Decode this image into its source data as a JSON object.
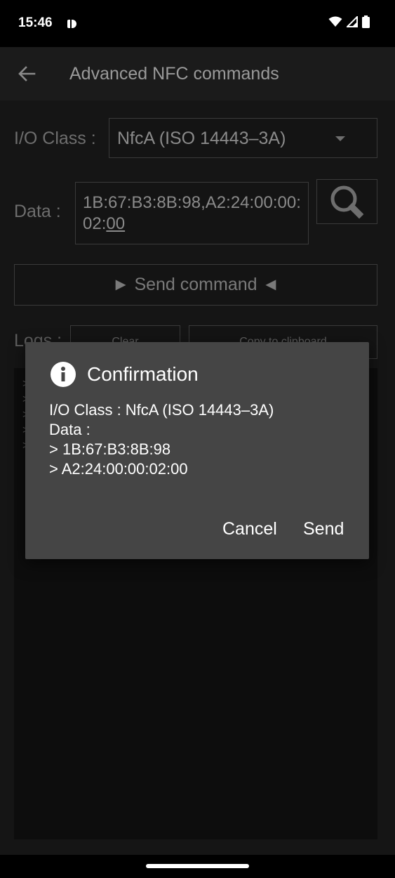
{
  "status_bar": {
    "time": "15:46"
  },
  "app_bar": {
    "title": "Advanced NFC commands"
  },
  "form": {
    "io_class_label": "I/O Class :",
    "io_class_value": "NfcA (ISO 14443–3A)",
    "data_label": "Data :",
    "data_value_main": "1B:67:B3:8B:98,A2:24:00:00:02:",
    "data_value_underlined": "00",
    "send_button": "► Send command ◄",
    "logs_label": "Logs :",
    "clear_button": "Clear",
    "copy_button": "Copy to clipboard"
  },
  "logs": {
    "line_prefixes": [
      ">",
      ">",
      ">",
      ">",
      ">"
    ]
  },
  "dialog": {
    "title": "Confirmation",
    "lines": [
      "I/O Class : NfcA (ISO 14443–3A)",
      "Data :",
      "> 1B:67:B3:8B:98",
      "> A2:24:00:00:02:00"
    ],
    "cancel_button": "Cancel",
    "send_button": "Send"
  },
  "icons": {
    "back": "arrow-left-icon",
    "search": "search-icon",
    "info": "info-icon",
    "wifi": "wifi-icon",
    "signal": "signal-icon",
    "battery": "battery-icon"
  }
}
